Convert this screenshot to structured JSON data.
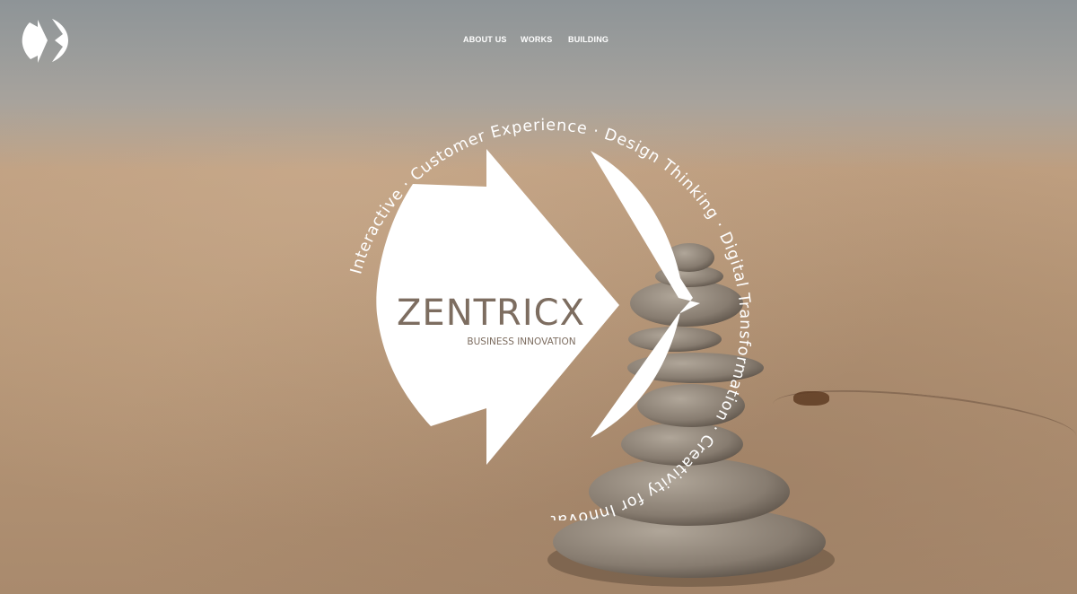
{
  "nav": {
    "items": [
      {
        "label": "ABOUT US"
      },
      {
        "label": "WORKS"
      },
      {
        "label": "BUILDING"
      }
    ]
  },
  "emblem": {
    "ring_text": "Interactive · Customer Experience · Design Thinking · Digital Transformation · Creativity for Innovative Business ·",
    "brand_name": "ZENTRICX",
    "tagline": "BUSINESS INNOVATION"
  },
  "colors": {
    "emblem_fill": "#ffffff",
    "brand_text": "#7d6d60",
    "nav_text": "#ffffff"
  },
  "icons": {
    "logo": "zentricx-logo-icon"
  }
}
